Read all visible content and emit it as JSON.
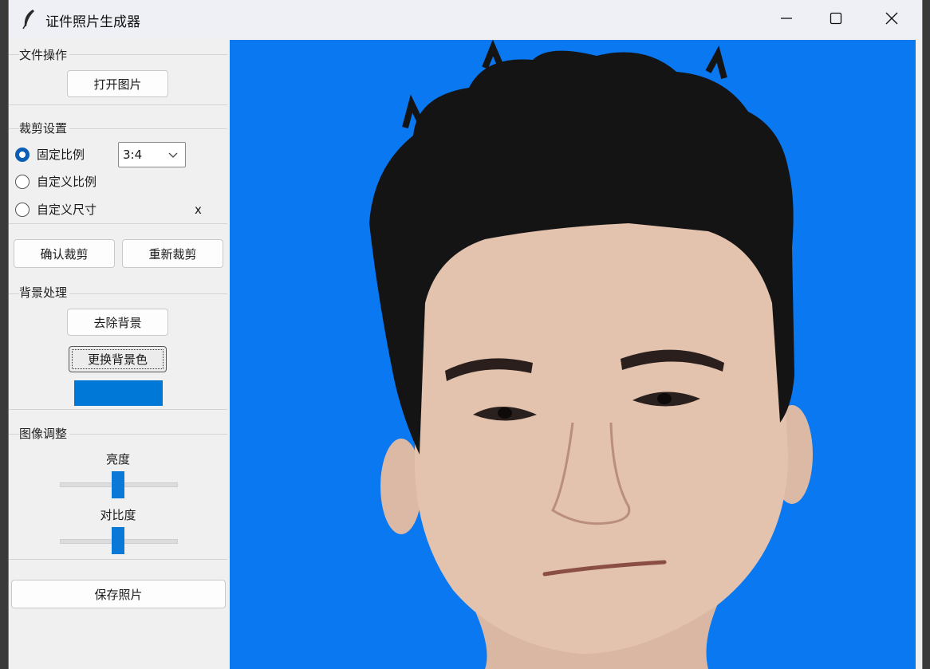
{
  "window": {
    "title": "证件照片生成器",
    "controls": [
      "minimize",
      "maximize",
      "close"
    ]
  },
  "file_ops": {
    "title": "文件操作",
    "open_label": "打开图片"
  },
  "crop": {
    "title": "裁剪设置",
    "options": [
      "固定比例",
      "自定义比例",
      "自定义尺寸"
    ],
    "selected": "固定比例",
    "ratio_value": "3:4",
    "size_separator": "x",
    "confirm_label": "确认裁剪",
    "reset_label": "重新裁剪"
  },
  "background": {
    "title": "背景处理",
    "remove_label": "去除背景",
    "change_color_label": "更换背景色",
    "current_color": "#0078d7"
  },
  "adjust": {
    "title": "图像调整",
    "brightness_label": "亮度",
    "contrast_label": "对比度",
    "brightness_level": 0.5,
    "contrast_level": 0.5
  },
  "save_label": "保存照片",
  "canvas": {
    "background_color": "#0a78f0",
    "content": "portrait-photo"
  },
  "colors": {
    "accent": "#0a5fb4",
    "slider_thumb": "#0a78d7"
  }
}
